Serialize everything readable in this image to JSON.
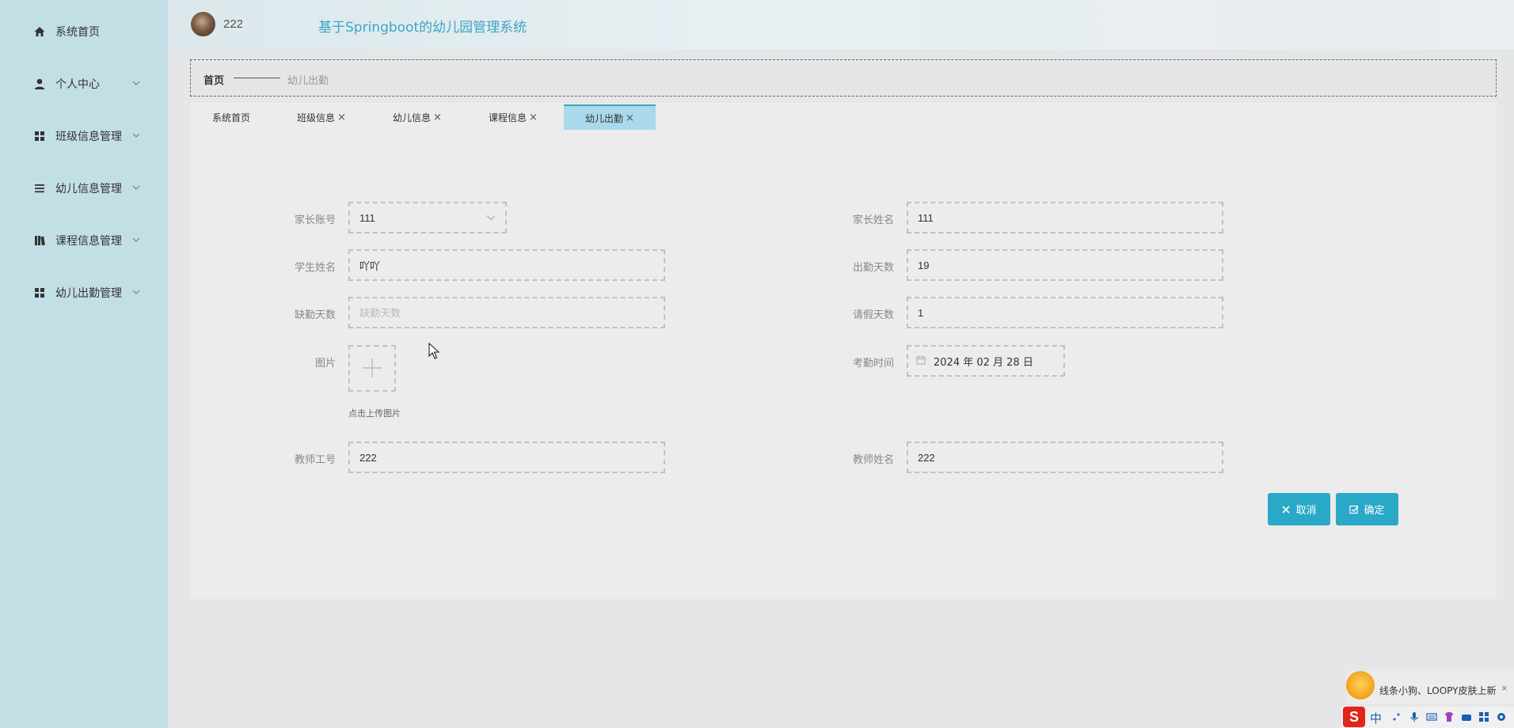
{
  "header": {
    "username": "222",
    "system_title": "基于Springboot的幼儿园管理系统"
  },
  "sidebar": {
    "items": [
      {
        "label": "系统首页",
        "icon": "home-icon",
        "has_submenu": false
      },
      {
        "label": "个人中心",
        "icon": "user-icon",
        "has_submenu": true
      },
      {
        "label": "班级信息管理",
        "icon": "grid-icon",
        "has_submenu": true
      },
      {
        "label": "幼儿信息管理",
        "icon": "list-icon",
        "has_submenu": true
      },
      {
        "label": "课程信息管理",
        "icon": "book-icon",
        "has_submenu": true
      },
      {
        "label": "幼儿出勤管理",
        "icon": "grid-icon",
        "has_submenu": true
      }
    ]
  },
  "breadcrumb": {
    "home": "首页",
    "current": "幼儿出勤"
  },
  "tabs": [
    {
      "label": "系统首页",
      "closable": false,
      "active": false
    },
    {
      "label": "班级信息",
      "closable": true,
      "active": false
    },
    {
      "label": "幼儿信息",
      "closable": true,
      "active": false
    },
    {
      "label": "课程信息",
      "closable": true,
      "active": false
    },
    {
      "label": "幼儿出勤",
      "closable": true,
      "active": true
    }
  ],
  "tab_close_glyph": "×",
  "form": {
    "parent_account": {
      "label": "家长账号",
      "value": "111"
    },
    "parent_name": {
      "label": "家长姓名",
      "value": "111"
    },
    "student_name": {
      "label": "学生姓名",
      "value": "吖吖"
    },
    "attendance_days": {
      "label": "出勤天数",
      "value": "19"
    },
    "absence_days": {
      "label": "缺勤天数",
      "value": "",
      "placeholder": "缺勤天数"
    },
    "leave_days": {
      "label": "请假天数",
      "value": "1"
    },
    "image": {
      "label": "图片",
      "hint": "点击上传图片"
    },
    "attendance_time": {
      "label": "考勤时间",
      "value": "2024 年 02 月 28 日"
    },
    "teacher_id": {
      "label": "教师工号",
      "value": "222"
    },
    "teacher_name": {
      "label": "教师姓名",
      "value": "222"
    }
  },
  "buttons": {
    "cancel": "取消",
    "confirm": "确定"
  },
  "ime": {
    "notice": "线条小狗、LOOPY皮肤上新",
    "close": "×",
    "logo": "S",
    "mode": "中"
  },
  "colors": {
    "sidebar_bg": "#c3dfe6",
    "accent": "#2aa8c8",
    "title": "#3aa6c6",
    "active_tab": "#a9d9ea"
  }
}
